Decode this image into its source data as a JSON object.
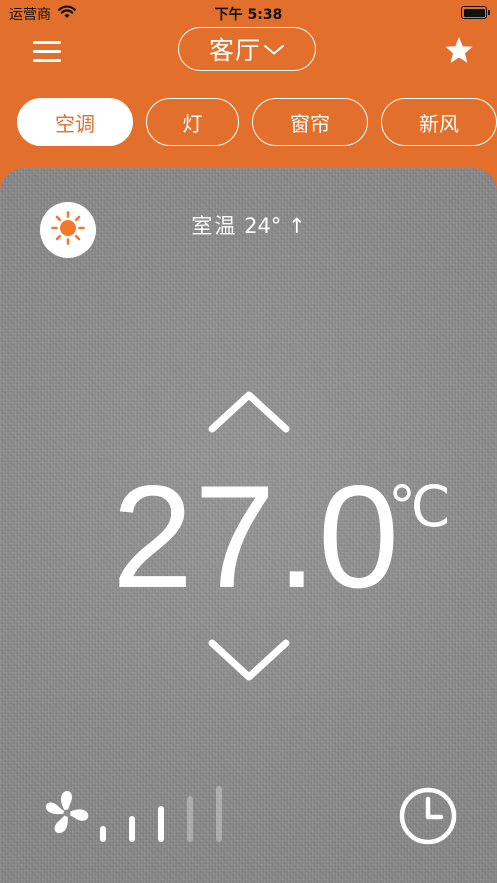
{
  "status_bar": {
    "carrier": "运营商",
    "time": "下午 5:38"
  },
  "header": {
    "menu_icon": "hamburger-menu-icon",
    "room": "客厅",
    "favorite_icon": "star-icon"
  },
  "tabs": [
    {
      "label": "空调",
      "active": true
    },
    {
      "label": "灯",
      "active": false
    },
    {
      "label": "窗帘",
      "active": false
    },
    {
      "label": "新风",
      "active": false
    }
  ],
  "climate": {
    "mode_icon": "sun-icon",
    "room_temp_label": "室温",
    "room_temp_value": "24°",
    "room_temp_trend": "↑",
    "setpoint": "27.0",
    "unit": "℃"
  },
  "fan": {
    "icon": "fan-icon",
    "levels_total": 5,
    "level_active": 3
  },
  "timer_icon": "clock-icon",
  "colors": {
    "accent": "#e26f2b",
    "panel": "#8e8e8e",
    "foreground": "#ffffff"
  }
}
